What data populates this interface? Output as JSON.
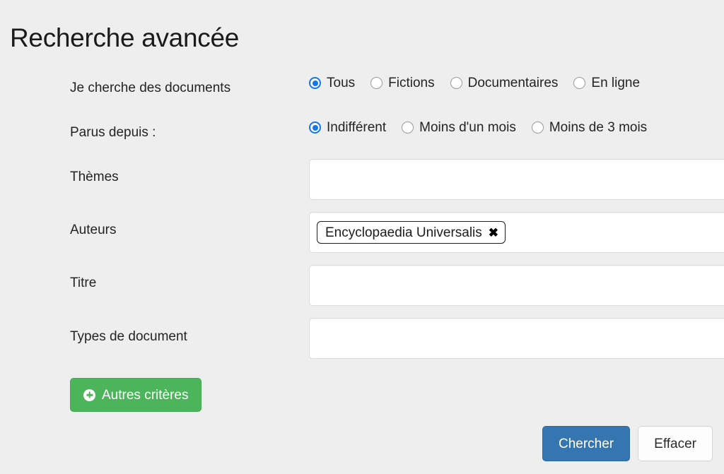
{
  "page": {
    "title": "Recherche avancée",
    "background_color": "#eeeeee"
  },
  "colors": {
    "accent_blue": "#3676b0",
    "radio_blue": "#1277e8",
    "green": "#4cb45a",
    "text": "#242424"
  },
  "form": {
    "doc_type": {
      "label": "Je cherche des documents",
      "options": [
        {
          "label": "Tous",
          "selected": true
        },
        {
          "label": "Fictions",
          "selected": false
        },
        {
          "label": "Documentaires",
          "selected": false
        },
        {
          "label": "En ligne",
          "selected": false
        }
      ]
    },
    "published_since": {
      "label": "Parus depuis :",
      "options": [
        {
          "label": "Indifférent",
          "selected": true
        },
        {
          "label": "Moins d'un mois",
          "selected": false
        },
        {
          "label": "Moins de 3 mois",
          "selected": false
        }
      ]
    },
    "themes": {
      "label": "Thèmes",
      "value": "",
      "placeholder": ""
    },
    "authors": {
      "label": "Auteurs",
      "value": "",
      "placeholder": "",
      "tags": [
        {
          "label": "Encyclopaedia Universalis",
          "remove_icon": "✖"
        }
      ]
    },
    "title_field": {
      "label": "Titre",
      "value": "",
      "placeholder": ""
    },
    "document_types": {
      "label": "Types de document",
      "value": "",
      "placeholder": ""
    }
  },
  "buttons": {
    "more_criteria": {
      "label": "Autres critères",
      "icon": "plus-circle-icon"
    },
    "search": {
      "label": "Chercher"
    },
    "clear": {
      "label": "Effacer"
    }
  }
}
